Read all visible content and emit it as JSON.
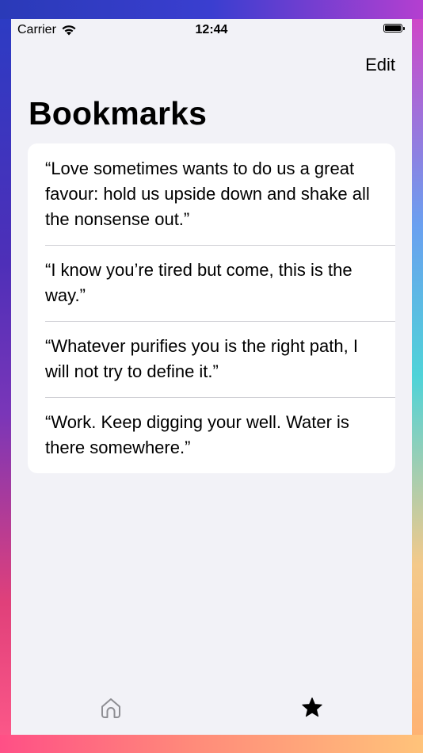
{
  "status_bar": {
    "carrier": "Carrier",
    "time": "12:44"
  },
  "nav": {
    "edit_label": "Edit",
    "title": "Bookmarks"
  },
  "bookmarks": [
    {
      "quote": "“Love sometimes wants to do us a great favour: hold us upside down and shake all the nonsense out.”"
    },
    {
      "quote": "“I know you’re tired but come, this is the way.”"
    },
    {
      "quote": "“Whatever purifies you is the right path, I will not try to define it.”"
    },
    {
      "quote": "“Work. Keep digging your well. Water is there somewhere.”"
    }
  ],
  "tab_bar": {
    "tabs": [
      {
        "icon": "house-icon",
        "selected": false
      },
      {
        "icon": "star-icon",
        "selected": true
      }
    ]
  },
  "colors": {
    "background": "#f2f2f7",
    "card": "#ffffff",
    "separator": "#d1d1d6",
    "tab_inactive": "#8e8e93",
    "tab_active": "#000000"
  }
}
